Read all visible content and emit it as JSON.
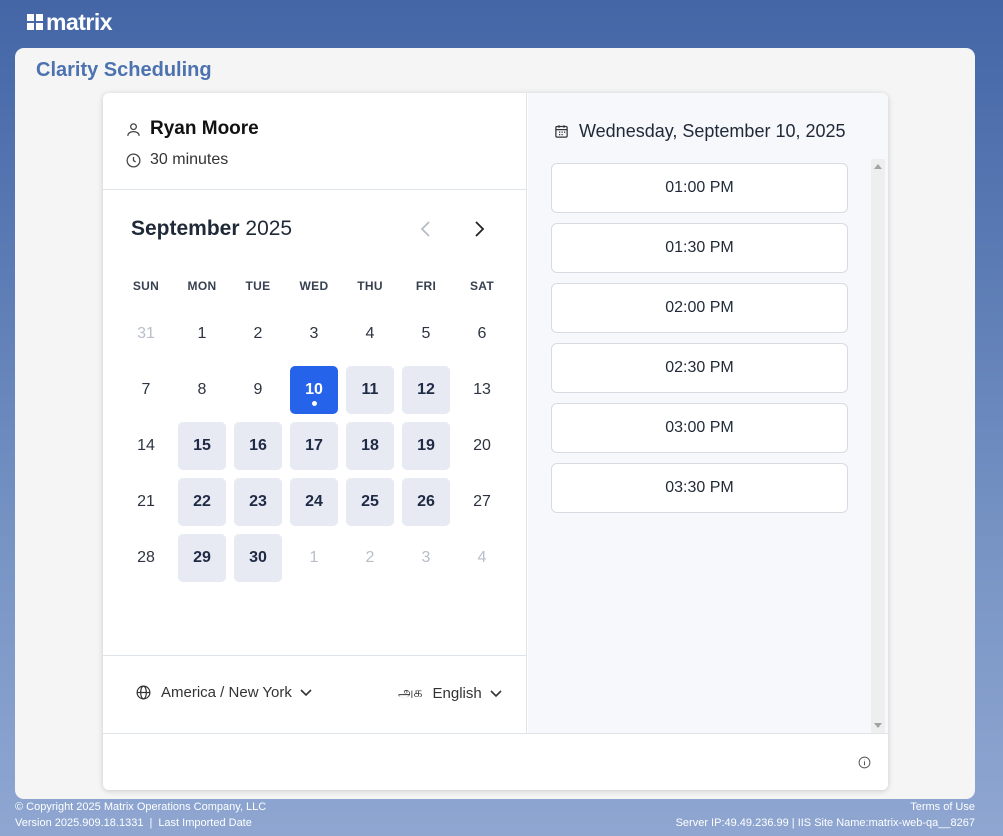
{
  "brand": {
    "name": "matrix"
  },
  "page": {
    "title": "Clarity Scheduling"
  },
  "host": {
    "name": "Ryan Moore",
    "duration": "30 minutes"
  },
  "calendar": {
    "month": "September",
    "year": "2025",
    "weekdays": [
      "SUN",
      "MON",
      "TUE",
      "WED",
      "THU",
      "FRI",
      "SAT"
    ],
    "days": [
      {
        "label": "31",
        "state": "muted"
      },
      {
        "label": "1",
        "state": "normal"
      },
      {
        "label": "2",
        "state": "normal"
      },
      {
        "label": "3",
        "state": "normal"
      },
      {
        "label": "4",
        "state": "normal"
      },
      {
        "label": "5",
        "state": "normal"
      },
      {
        "label": "6",
        "state": "normal"
      },
      {
        "label": "7",
        "state": "normal"
      },
      {
        "label": "8",
        "state": "normal"
      },
      {
        "label": "9",
        "state": "normal"
      },
      {
        "label": "10",
        "state": "selected"
      },
      {
        "label": "11",
        "state": "available"
      },
      {
        "label": "12",
        "state": "available"
      },
      {
        "label": "13",
        "state": "normal"
      },
      {
        "label": "14",
        "state": "normal"
      },
      {
        "label": "15",
        "state": "available"
      },
      {
        "label": "16",
        "state": "available"
      },
      {
        "label": "17",
        "state": "available"
      },
      {
        "label": "18",
        "state": "available"
      },
      {
        "label": "19",
        "state": "available"
      },
      {
        "label": "20",
        "state": "normal"
      },
      {
        "label": "21",
        "state": "normal"
      },
      {
        "label": "22",
        "state": "available"
      },
      {
        "label": "23",
        "state": "available"
      },
      {
        "label": "24",
        "state": "available"
      },
      {
        "label": "25",
        "state": "available"
      },
      {
        "label": "26",
        "state": "available"
      },
      {
        "label": "27",
        "state": "normal"
      },
      {
        "label": "28",
        "state": "normal"
      },
      {
        "label": "29",
        "state": "available"
      },
      {
        "label": "30",
        "state": "available"
      },
      {
        "label": "1",
        "state": "muted"
      },
      {
        "label": "2",
        "state": "muted"
      },
      {
        "label": "3",
        "state": "muted"
      },
      {
        "label": "4",
        "state": "muted"
      }
    ]
  },
  "timezone": {
    "value": "America / New York"
  },
  "language": {
    "glyph": "அக",
    "value": "English"
  },
  "slots_panel": {
    "date": "Wednesday, September 10, 2025",
    "slots": [
      "01:00 PM",
      "01:30 PM",
      "02:00 PM",
      "02:30 PM",
      "03:00 PM",
      "03:30 PM"
    ]
  },
  "footer": {
    "copyright": "© Copyright 2025 Matrix Operations Company, LLC",
    "version": "Version 2025.909.18.1331",
    "last_imported": "Last Imported Date",
    "terms": "Terms of Use",
    "server": "Server IP:49.49.236.99 | IIS Site Name:matrix-web-qa__8267"
  },
  "colors": {
    "accent": "#2563eb",
    "title": "#4d72b0",
    "available_bg": "#e7e9f3"
  }
}
